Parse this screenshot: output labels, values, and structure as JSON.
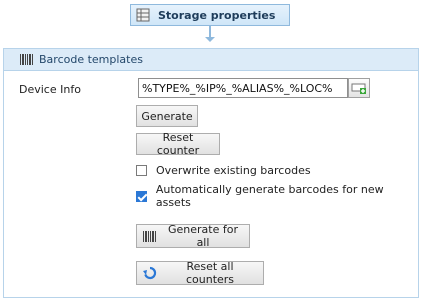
{
  "node": {
    "label": "Storage properties",
    "icon": "storage-grid-icon"
  },
  "panel": {
    "title": "Barcode templates",
    "icon": "barcode-icon"
  },
  "device_info": {
    "label": "Device Info",
    "value": "%TYPE%_%IP%_%ALIAS%_%LOC%",
    "edit_icon": "insert-field-icon"
  },
  "buttons": {
    "generate": "Generate",
    "reset_counter": "Reset counter",
    "generate_all": "Generate for all",
    "reset_all": "Reset all counters"
  },
  "checkboxes": [
    {
      "label": "Overwrite existing barcodes",
      "checked": false
    },
    {
      "label": "Automatically generate barcodes for new assets",
      "checked": true
    }
  ],
  "colors": {
    "accent": "#2b78d6",
    "header_bg": "#dcebf8",
    "border": "#b7d3ea"
  }
}
